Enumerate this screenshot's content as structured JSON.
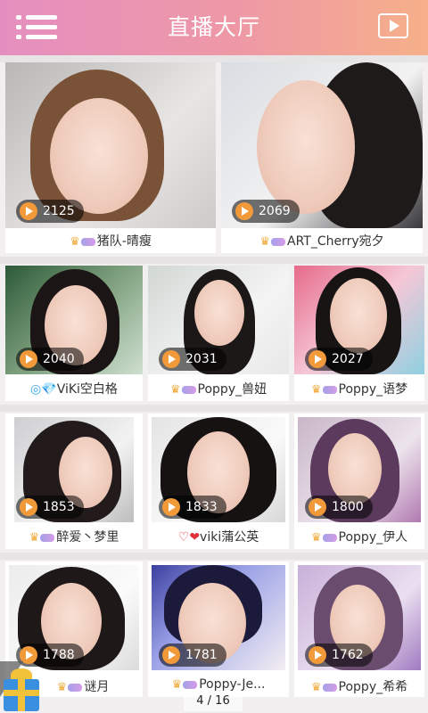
{
  "header": {
    "title": "直播大厅",
    "menu_icon": "menu-list-icon",
    "video_icon": "video-play-icon"
  },
  "streams": [
    {
      "viewers": "2125",
      "name": "猪队-晴瘦",
      "prefix": "crown-level"
    },
    {
      "viewers": "2069",
      "name": "ART_Cherry宛夕",
      "prefix": "crown-level"
    },
    {
      "viewers": "2040",
      "name": "ViKi空白格",
      "prefix": "diamond"
    },
    {
      "viewers": "2031",
      "name": "Poppy_兽妞",
      "prefix": "crown-level"
    },
    {
      "viewers": "2027",
      "name": "Poppy_语梦",
      "prefix": "crown-level"
    },
    {
      "viewers": "1853",
      "name": "醉爱丶梦里",
      "prefix": "crown-level"
    },
    {
      "viewers": "1833",
      "name": "viki蒲公英",
      "prefix": "heart"
    },
    {
      "viewers": "1800",
      "name": "Poppy_伊人",
      "prefix": "crown-level"
    },
    {
      "viewers": "1788",
      "name": "谜月",
      "prefix": "crown-level"
    },
    {
      "viewers": "1781",
      "name": "Poppy-Je...",
      "prefix": "crown-level"
    },
    {
      "viewers": "1762",
      "name": "Poppy_希希",
      "prefix": "crown-level"
    }
  ],
  "pager": {
    "text": "4 / 16"
  },
  "gift_icon": "gift-box-icon",
  "colors": {
    "header_start": "#e58fc0",
    "header_end": "#f6b089",
    "badge_play": "#f29a3a"
  }
}
